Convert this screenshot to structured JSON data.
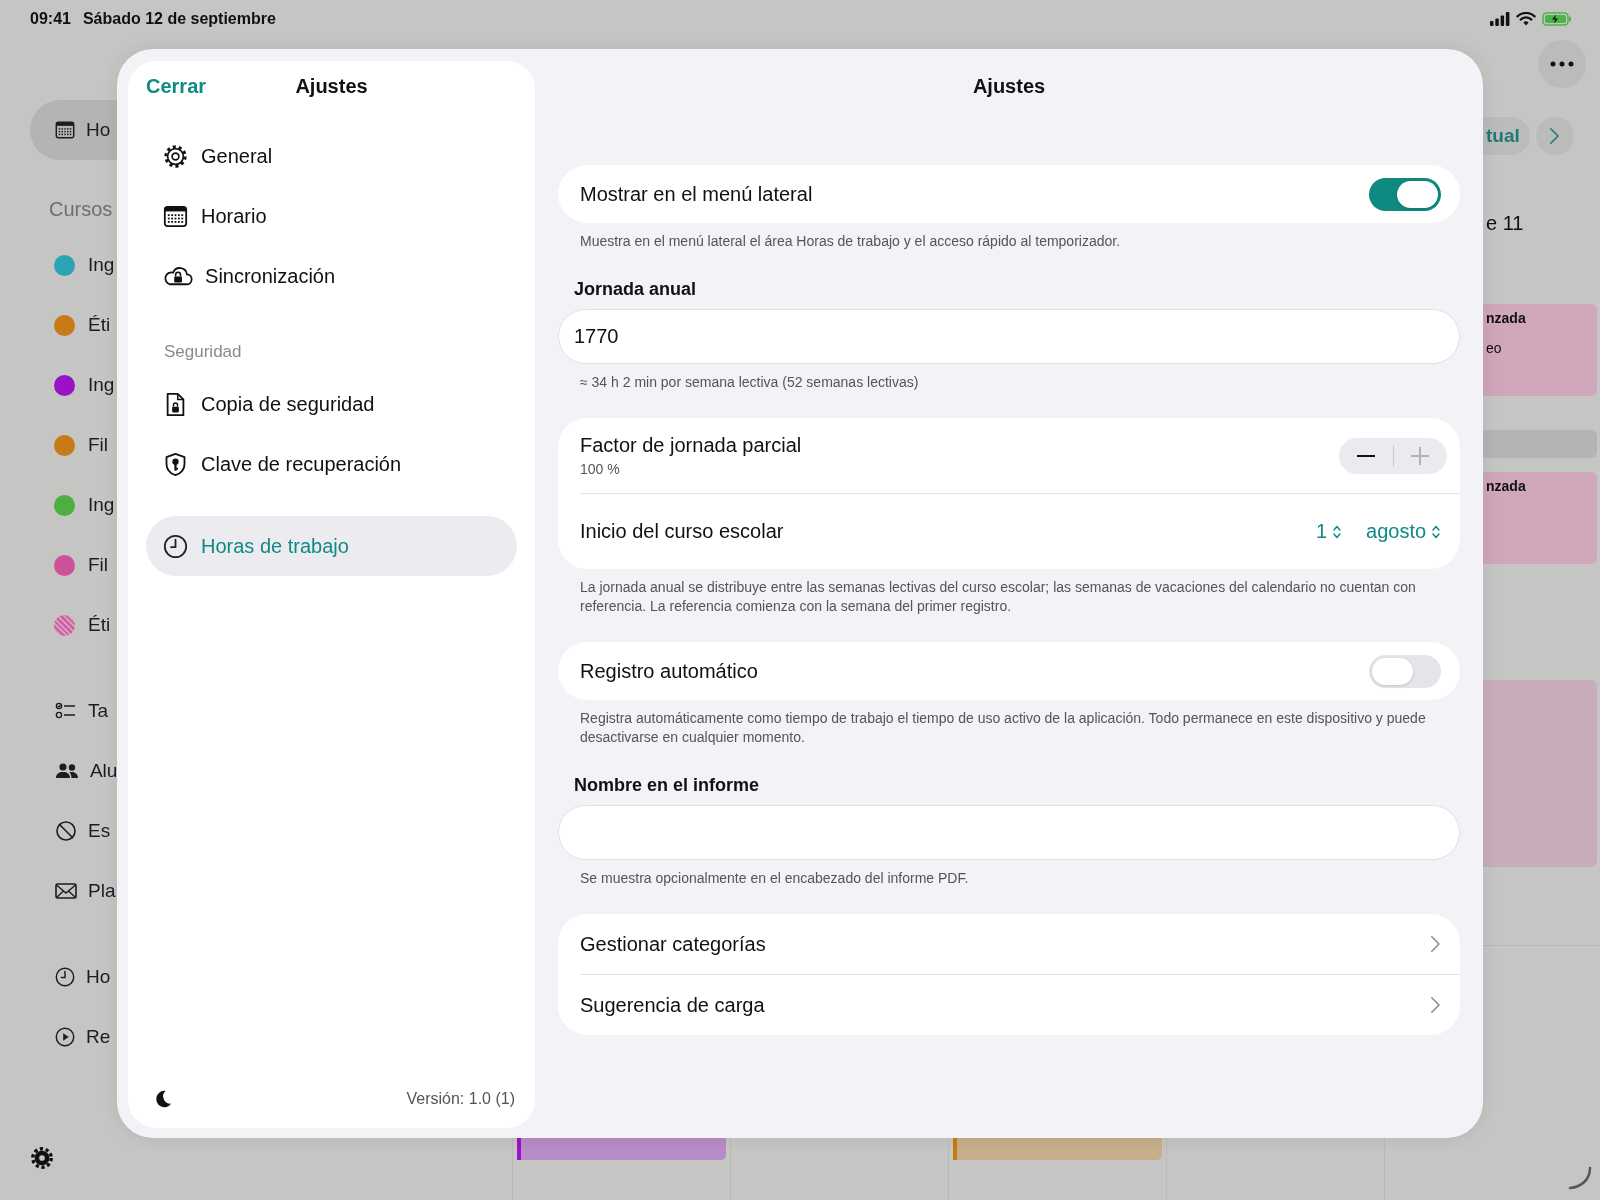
{
  "status_bar": {
    "time": "09:41",
    "date": "Sábado 12 de septiembre"
  },
  "background": {
    "sidebar": {
      "current": {
        "label": "Ho",
        "selected": true
      },
      "section": "Cursos",
      "courses": [
        {
          "label": "Ing",
          "color": "#2aa3b3",
          "pattern": false
        },
        {
          "label": "Éti",
          "color": "#c77a15",
          "pattern": false
        },
        {
          "label": "Ing",
          "color": "#9a12c4",
          "pattern": false
        },
        {
          "label": "Fil",
          "color": "#c77a15",
          "pattern": false
        },
        {
          "label": "Ing",
          "color": "#4caf3e",
          "pattern": false
        },
        {
          "label": "Fil",
          "color": "#cd5299",
          "pattern": false
        },
        {
          "label": "Éti",
          "color": "#c9609e",
          "pattern": true
        }
      ],
      "tools": [
        {
          "label": "Ta"
        },
        {
          "label": "Alu"
        },
        {
          "label": "Es"
        },
        {
          "label": "Pla"
        }
      ],
      "extras": [
        {
          "label": "Ho"
        },
        {
          "label": "Re"
        }
      ]
    },
    "calendar": {
      "today_button": "tual",
      "day_label": "e 11",
      "events": [
        {
          "title": "nzada",
          "detail": "eo",
          "color": "#cfa6ba"
        },
        {
          "title": "nzada",
          "color": "#cfa6ba"
        },
        {
          "color": "#c9acbb"
        }
      ],
      "bottom_events": [
        {
          "color": "#9b10c9"
        },
        {
          "color": "#c97a10"
        }
      ]
    }
  },
  "sheet": {
    "close": "Cerrar",
    "title": "Ajustes",
    "nav": [
      {
        "items": [
          {
            "label": "General",
            "selected": false
          },
          {
            "label": "Horario",
            "selected": false
          },
          {
            "label": "Sincronización",
            "selected": false
          }
        ]
      },
      {
        "header": "Seguridad",
        "items": [
          {
            "label": "Copia de seguridad",
            "selected": false
          },
          {
            "label": "Clave de recuperación",
            "selected": false
          }
        ]
      },
      {
        "items": [
          {
            "label": "Horas de trabajo",
            "selected": true
          }
        ]
      }
    ],
    "version": "Versión: 1.0 (1)",
    "detail": {
      "title": "Ajustes",
      "groups": [
        {
          "rows": [
            {
              "kind": "toggle",
              "label": "Mostrar en el menú lateral",
              "on": true
            }
          ],
          "footer": "Muestra en el menú lateral el área Horas de trabajo y el acceso rápido al temporizador."
        },
        {
          "header": "Jornada anual",
          "rows": [
            {
              "kind": "field",
              "value": "1770"
            }
          ],
          "footer": "≈ 34 h 2 min por semana lectiva (52 semanas lectivas)"
        },
        {
          "rows": [
            {
              "kind": "stepper",
              "label": "Factor de jornada parcial",
              "value": "100 %",
              "minus_disabled": false,
              "plus_disabled": true
            },
            {
              "kind": "picker",
              "label": "Inicio del curso escolar",
              "options": [
                "1",
                "agosto"
              ]
            }
          ],
          "footer": "La jornada anual se distribuye entre las semanas lectivas del curso escolar; las semanas de vacaciones del calendario no cuentan con referencia. La referencia comienza con la semana del primer registro."
        },
        {
          "rows": [
            {
              "kind": "toggle",
              "label": "Registro automático",
              "on": false
            }
          ],
          "footer": "Registra automáticamente como tiempo de trabajo el tiempo de uso activo de la aplicación. Todo permanece en este dispositivo y puede desactivarse en cualquier momento."
        },
        {
          "header": "Nombre en el informe",
          "rows": [
            {
              "kind": "field"
            }
          ],
          "footer": "Se muestra opcionalmente en el encabezado del informe PDF."
        },
        {
          "rows": [
            {
              "kind": "link",
              "label": "Gestionar categorías"
            },
            {
              "kind": "link",
              "label": "Sugerencia de carga"
            }
          ]
        }
      ]
    }
  }
}
